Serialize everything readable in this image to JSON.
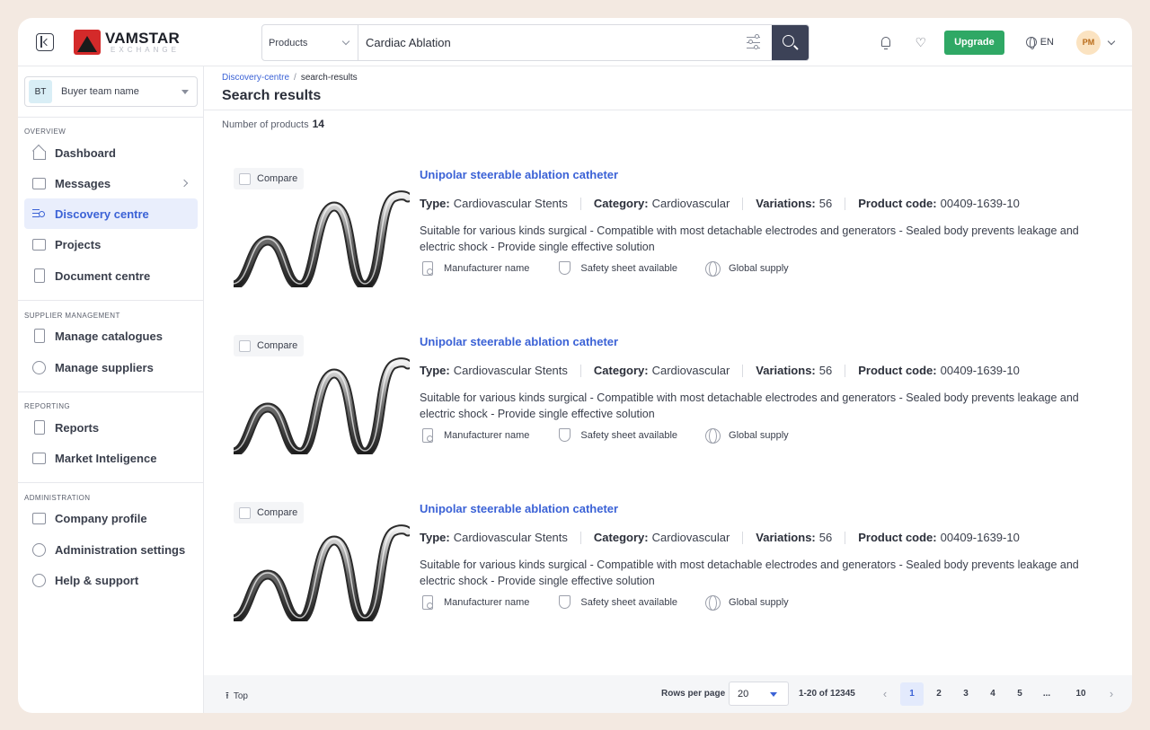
{
  "header": {
    "logo_name": "VAMSTAR",
    "logo_sub": "EXCHANGE",
    "search_scope": "Products",
    "search_value": "Cardiac Ablation",
    "upgrade_label": "Upgrade",
    "language": "EN",
    "avatar_initials": "PM"
  },
  "sidebar": {
    "team_initials": "BT",
    "team_name": "Buyer team name",
    "sections": {
      "overview": "OVERVIEW",
      "supplier": "SUPPLIER MANAGEMENT",
      "reporting": "REPORTING",
      "administration": "ADMINISTRATION"
    },
    "items": {
      "dashboard": "Dashboard",
      "messages": "Messages",
      "discovery": "Discovery centre",
      "projects": "Projects",
      "documents": "Document centre",
      "catalogues": "Manage catalogues",
      "suppliers": "Manage suppliers",
      "reports": "Reports",
      "market": "Market Inteligence",
      "company": "Company profile",
      "admin_settings": "Administration settings",
      "help": "Help & support"
    }
  },
  "main": {
    "breadcrumb_link": "Discovery-centre",
    "breadcrumb_sep": "/",
    "breadcrumb_current": "search-results",
    "title": "Search results",
    "count_label": "Number of products",
    "count_value": "14",
    "compare_label": "Compare",
    "labels": {
      "type": "Type:",
      "category": "Category:",
      "variations": "Variations:",
      "product_code": "Product code:"
    },
    "products": [
      {
        "title": "Unipolar steerable ablation catheter",
        "type": "Cardiovascular Stents",
        "category": "Cardiovascular",
        "variations": "56",
        "code": "00409-1639-10",
        "description": "Suitable for various kinds surgical - Compatible with most detachable electrodes and generators - Sealed body prevents leakage and electric shock - Provide single effective solution",
        "manufacturer": "Manufacturer name",
        "safety": "Safety sheet available",
        "supply": "Global supply"
      },
      {
        "title": "Unipolar steerable ablation catheter",
        "type": "Cardiovascular Stents",
        "category": "Cardiovascular",
        "variations": "56",
        "code": "00409-1639-10",
        "description": "Suitable for various kinds surgical - Compatible with most detachable electrodes and generators - Sealed body prevents leakage and electric shock - Provide single effective solution",
        "manufacturer": "Manufacturer name",
        "safety": "Safety sheet available",
        "supply": "Global supply"
      },
      {
        "title": "Unipolar steerable ablation catheter",
        "type": "Cardiovascular Stents",
        "category": "Cardiovascular",
        "variations": "56",
        "code": "00409-1639-10",
        "description": "Suitable for various kinds surgical - Compatible with most detachable electrodes and generators - Sealed body prevents leakage and electric shock - Provide single effective solution",
        "manufacturer": "Manufacturer name",
        "safety": "Safety sheet available",
        "supply": "Global supply"
      }
    ]
  },
  "footer": {
    "top_label": "Top",
    "rows_label": "Rows per page",
    "rows_value": "20",
    "range": "1-20 of 12345",
    "pages": [
      "1",
      "2",
      "3",
      "4",
      "5",
      "...",
      "10"
    ],
    "prev_icon": "‹",
    "next_icon": "›"
  },
  "colors": {
    "accent": "#3b62d6",
    "upgrade": "#2fa865",
    "search_button": "#3c4257",
    "page_bg": "#f3e9e1"
  }
}
